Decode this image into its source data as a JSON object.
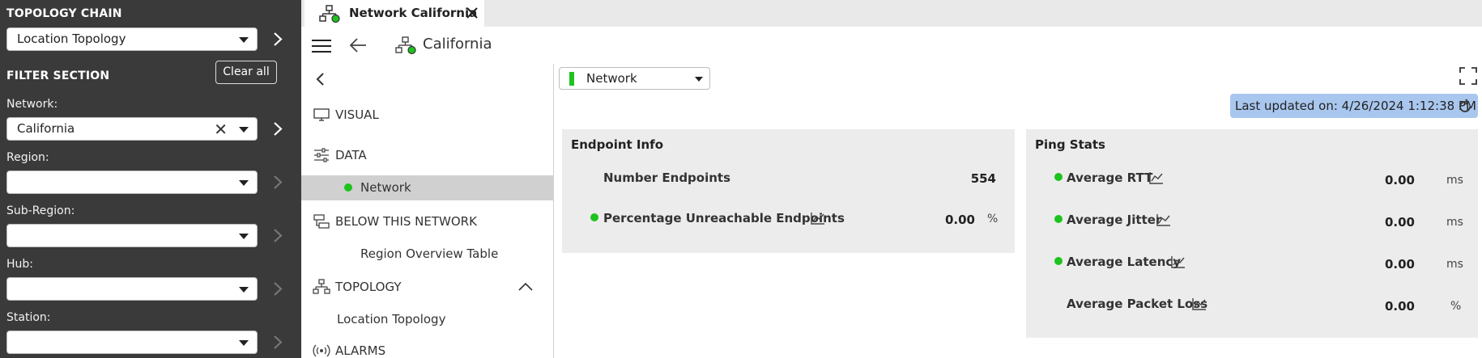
{
  "filter_panel": {
    "topology_heading": "TOPOLOGY CHAIN",
    "topology_value": "Location Topology",
    "filter_heading": "FILTER SECTION",
    "clear_all": "Clear all",
    "network_label": "Network:",
    "network_value": "California",
    "region_label": "Region:",
    "region_value": "",
    "subregion_label": "Sub-Region:",
    "subregion_value": "",
    "hub_label": "Hub:",
    "hub_value": "",
    "station_label": "Station:",
    "station_value": ""
  },
  "tab": {
    "label": "Network California"
  },
  "header": {
    "title": "California"
  },
  "nav": {
    "visual": "VISUAL",
    "data": "DATA",
    "network": "Network",
    "below": "BELOW THIS NETWORK",
    "region_overview": "Region Overview Table",
    "topology": "TOPOLOGY",
    "location_topology": "Location Topology",
    "alarms": "ALARMS"
  },
  "main": {
    "network_select": "Network",
    "last_updated": "Last updated on: 4/26/2024 1:12:38 PM",
    "endpoint_info": {
      "title": "Endpoint Info",
      "number_endpoints_label": "Number Endpoints",
      "number_endpoints_value": "554",
      "pct_unreachable_label": "Percentage Unreachable Endpoints",
      "pct_unreachable_value": "0.00",
      "pct_unreachable_unit": "%"
    },
    "ping_stats": {
      "title": "Ping Stats",
      "rtt_label": "Average RTT",
      "rtt_value": "0.00",
      "rtt_unit": "ms",
      "jitter_label": "Average Jitter",
      "jitter_value": "0.00",
      "jitter_unit": "ms",
      "latency_label": "Average Latency",
      "latency_value": "0.00",
      "latency_unit": "ms",
      "packet_loss_label": "Average Packet Loss",
      "packet_loss_value": "0.00",
      "packet_loss_unit": "%"
    }
  },
  "colors": {
    "panel_bg": "#3a3a3a",
    "status_green": "#1ec31e",
    "updated_bg": "#a9c7ee",
    "card_bg": "#ececec",
    "nav_selected_bg": "#d0d0d0"
  },
  "icons": [
    "chevron-right-icon",
    "close-icon",
    "caret-down-icon",
    "topology-icon",
    "hamburger-icon",
    "back-arrow-icon",
    "collapse-chevron-icon",
    "monitor-icon",
    "sliders-icon",
    "hierarchy-icon",
    "chevron-up-icon",
    "broadcast-icon",
    "expand-icon",
    "refresh-icon",
    "trend-chart-icon"
  ]
}
